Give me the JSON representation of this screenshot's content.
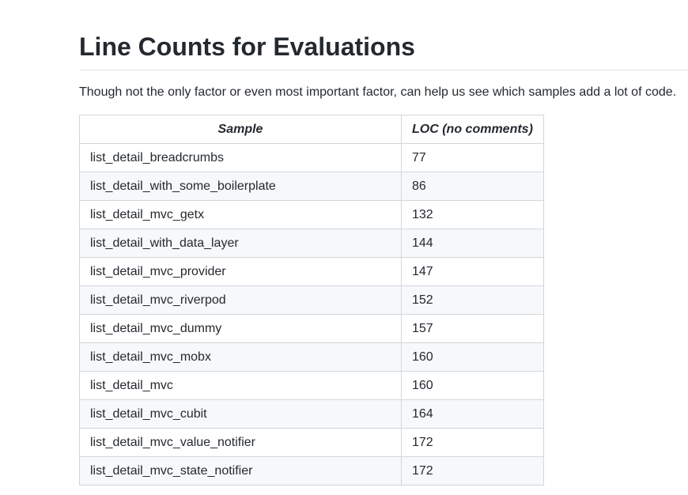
{
  "page": {
    "title": "Line Counts for Evaluations",
    "lead": "Though not the only factor or even most important factor, can help us see which samples add a lot of code."
  },
  "table": {
    "headers": [
      "Sample",
      "LOC (no comments)"
    ],
    "rows": [
      [
        "list_detail_breadcrumbs",
        "77"
      ],
      [
        "list_detail_with_some_boilerplate",
        "86"
      ],
      [
        "list_detail_mvc_getx",
        "132"
      ],
      [
        "list_detail_with_data_layer",
        "144"
      ],
      [
        "list_detail_mvc_provider",
        "147"
      ],
      [
        "list_detail_mvc_riverpod",
        "152"
      ],
      [
        "list_detail_mvc_dummy",
        "157"
      ],
      [
        "list_detail_mvc_mobx",
        "160"
      ],
      [
        "list_detail_mvc",
        "160"
      ],
      [
        "list_detail_mvc_cubit",
        "164"
      ],
      [
        "list_detail_mvc_value_notifier",
        "172"
      ],
      [
        "list_detail_mvc_state_notifier",
        "172"
      ]
    ]
  }
}
